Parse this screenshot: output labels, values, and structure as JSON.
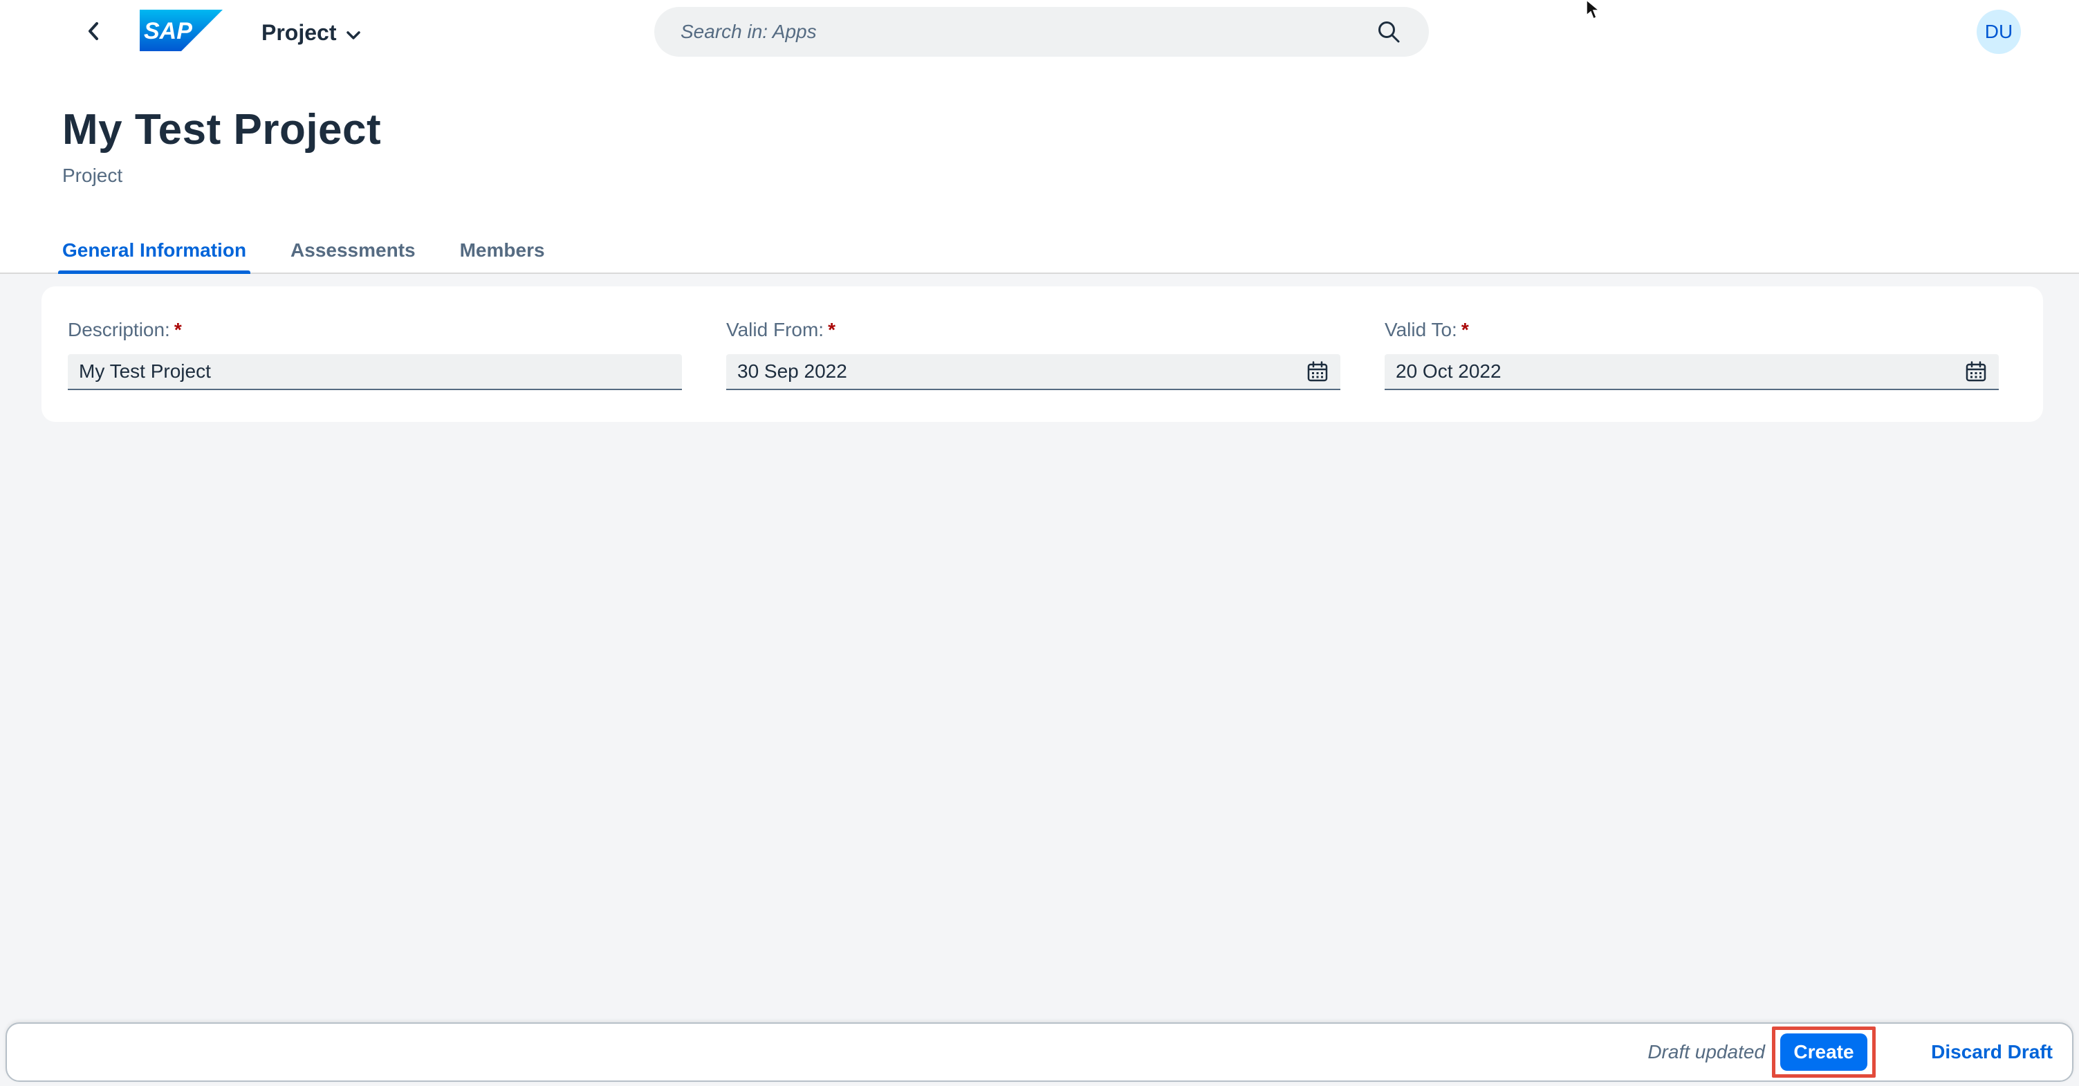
{
  "shell": {
    "app_title": "Project",
    "logo_text": "SAP",
    "search_placeholder": "Search in: Apps",
    "avatar_initials": "DU"
  },
  "header": {
    "title": "My Test Project",
    "subtitle": "Project"
  },
  "tabs": [
    {
      "label": "General Information",
      "active": true
    },
    {
      "label": "Assessments",
      "active": false
    },
    {
      "label": "Members",
      "active": false
    }
  ],
  "form": {
    "description": {
      "label": "Description:",
      "required_mark": "*",
      "value": "My Test Project"
    },
    "valid_from": {
      "label": "Valid From:",
      "required_mark": "*",
      "value": "30 Sep 2022"
    },
    "valid_to": {
      "label": "Valid To:",
      "required_mark": "*",
      "value": "20 Oct 2022"
    }
  },
  "footer": {
    "status": "Draft updated",
    "create_label": "Create",
    "discard_label": "Discard Draft"
  },
  "colors": {
    "brand_blue": "#0070f2",
    "link_blue": "#0064d9",
    "required_red": "#aa0808",
    "highlight_red": "#e24b3b",
    "background": "#f4f5f7"
  }
}
